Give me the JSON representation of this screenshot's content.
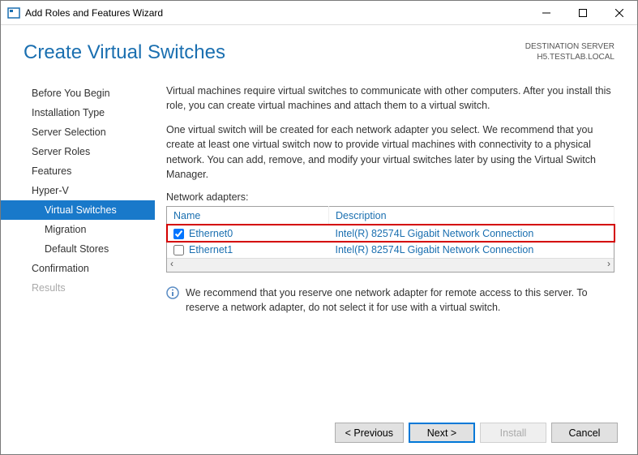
{
  "titlebar": {
    "title": "Add Roles and Features Wizard"
  },
  "header": {
    "title": "Create Virtual Switches",
    "server_label": "DESTINATION SERVER",
    "server_name": "H5.TESTLAB.LOCAL"
  },
  "nav": {
    "items": [
      {
        "label": "Before You Begin"
      },
      {
        "label": "Installation Type"
      },
      {
        "label": "Server Selection"
      },
      {
        "label": "Server Roles"
      },
      {
        "label": "Features"
      },
      {
        "label": "Hyper-V"
      },
      {
        "label": "Virtual Switches"
      },
      {
        "label": "Migration"
      },
      {
        "label": "Default Stores"
      },
      {
        "label": "Confirmation"
      },
      {
        "label": "Results"
      }
    ]
  },
  "content": {
    "para1": "Virtual machines require virtual switches to communicate with other computers. After you install this role, you can create virtual machines and attach them to a virtual switch.",
    "para2": "One virtual switch will be created for each network adapter you select. We recommend that you create at least one virtual switch now to provide virtual machines with connectivity to a physical network. You can add, remove, and modify your virtual switches later by using the Virtual Switch Manager.",
    "adapters_label": "Network adapters:",
    "table": {
      "col_name": "Name",
      "col_desc": "Description",
      "rows": [
        {
          "name": "Ethernet0",
          "desc": "Intel(R) 82574L Gigabit Network Connection",
          "checked": true
        },
        {
          "name": "Ethernet1",
          "desc": "Intel(R) 82574L Gigabit Network Connection",
          "checked": false
        }
      ]
    },
    "info": "We recommend that you reserve one network adapter for remote access to this server. To reserve a network adapter, do not select it for use with a virtual switch."
  },
  "footer": {
    "prev": "< Previous",
    "next": "Next >",
    "install": "Install",
    "cancel": "Cancel"
  }
}
